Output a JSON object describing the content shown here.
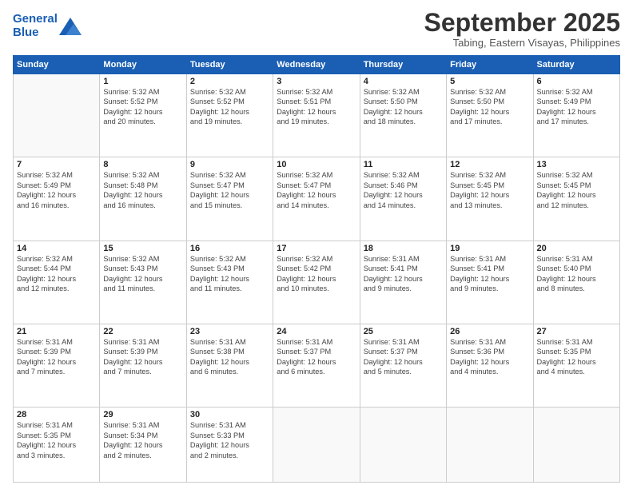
{
  "header": {
    "logo_line1": "General",
    "logo_line2": "Blue",
    "month_title": "September 2025",
    "subtitle": "Tabing, Eastern Visayas, Philippines"
  },
  "days_of_week": [
    "Sunday",
    "Monday",
    "Tuesday",
    "Wednesday",
    "Thursday",
    "Friday",
    "Saturday"
  ],
  "weeks": [
    [
      {
        "day": "",
        "info": ""
      },
      {
        "day": "1",
        "info": "Sunrise: 5:32 AM\nSunset: 5:52 PM\nDaylight: 12 hours\nand 20 minutes."
      },
      {
        "day": "2",
        "info": "Sunrise: 5:32 AM\nSunset: 5:52 PM\nDaylight: 12 hours\nand 19 minutes."
      },
      {
        "day": "3",
        "info": "Sunrise: 5:32 AM\nSunset: 5:51 PM\nDaylight: 12 hours\nand 19 minutes."
      },
      {
        "day": "4",
        "info": "Sunrise: 5:32 AM\nSunset: 5:50 PM\nDaylight: 12 hours\nand 18 minutes."
      },
      {
        "day": "5",
        "info": "Sunrise: 5:32 AM\nSunset: 5:50 PM\nDaylight: 12 hours\nand 17 minutes."
      },
      {
        "day": "6",
        "info": "Sunrise: 5:32 AM\nSunset: 5:49 PM\nDaylight: 12 hours\nand 17 minutes."
      }
    ],
    [
      {
        "day": "7",
        "info": "Sunrise: 5:32 AM\nSunset: 5:49 PM\nDaylight: 12 hours\nand 16 minutes."
      },
      {
        "day": "8",
        "info": "Sunrise: 5:32 AM\nSunset: 5:48 PM\nDaylight: 12 hours\nand 16 minutes."
      },
      {
        "day": "9",
        "info": "Sunrise: 5:32 AM\nSunset: 5:47 PM\nDaylight: 12 hours\nand 15 minutes."
      },
      {
        "day": "10",
        "info": "Sunrise: 5:32 AM\nSunset: 5:47 PM\nDaylight: 12 hours\nand 14 minutes."
      },
      {
        "day": "11",
        "info": "Sunrise: 5:32 AM\nSunset: 5:46 PM\nDaylight: 12 hours\nand 14 minutes."
      },
      {
        "day": "12",
        "info": "Sunrise: 5:32 AM\nSunset: 5:45 PM\nDaylight: 12 hours\nand 13 minutes."
      },
      {
        "day": "13",
        "info": "Sunrise: 5:32 AM\nSunset: 5:45 PM\nDaylight: 12 hours\nand 12 minutes."
      }
    ],
    [
      {
        "day": "14",
        "info": "Sunrise: 5:32 AM\nSunset: 5:44 PM\nDaylight: 12 hours\nand 12 minutes."
      },
      {
        "day": "15",
        "info": "Sunrise: 5:32 AM\nSunset: 5:43 PM\nDaylight: 12 hours\nand 11 minutes."
      },
      {
        "day": "16",
        "info": "Sunrise: 5:32 AM\nSunset: 5:43 PM\nDaylight: 12 hours\nand 11 minutes."
      },
      {
        "day": "17",
        "info": "Sunrise: 5:32 AM\nSunset: 5:42 PM\nDaylight: 12 hours\nand 10 minutes."
      },
      {
        "day": "18",
        "info": "Sunrise: 5:31 AM\nSunset: 5:41 PM\nDaylight: 12 hours\nand 9 minutes."
      },
      {
        "day": "19",
        "info": "Sunrise: 5:31 AM\nSunset: 5:41 PM\nDaylight: 12 hours\nand 9 minutes."
      },
      {
        "day": "20",
        "info": "Sunrise: 5:31 AM\nSunset: 5:40 PM\nDaylight: 12 hours\nand 8 minutes."
      }
    ],
    [
      {
        "day": "21",
        "info": "Sunrise: 5:31 AM\nSunset: 5:39 PM\nDaylight: 12 hours\nand 7 minutes."
      },
      {
        "day": "22",
        "info": "Sunrise: 5:31 AM\nSunset: 5:39 PM\nDaylight: 12 hours\nand 7 minutes."
      },
      {
        "day": "23",
        "info": "Sunrise: 5:31 AM\nSunset: 5:38 PM\nDaylight: 12 hours\nand 6 minutes."
      },
      {
        "day": "24",
        "info": "Sunrise: 5:31 AM\nSunset: 5:37 PM\nDaylight: 12 hours\nand 6 minutes."
      },
      {
        "day": "25",
        "info": "Sunrise: 5:31 AM\nSunset: 5:37 PM\nDaylight: 12 hours\nand 5 minutes."
      },
      {
        "day": "26",
        "info": "Sunrise: 5:31 AM\nSunset: 5:36 PM\nDaylight: 12 hours\nand 4 minutes."
      },
      {
        "day": "27",
        "info": "Sunrise: 5:31 AM\nSunset: 5:35 PM\nDaylight: 12 hours\nand 4 minutes."
      }
    ],
    [
      {
        "day": "28",
        "info": "Sunrise: 5:31 AM\nSunset: 5:35 PM\nDaylight: 12 hours\nand 3 minutes."
      },
      {
        "day": "29",
        "info": "Sunrise: 5:31 AM\nSunset: 5:34 PM\nDaylight: 12 hours\nand 2 minutes."
      },
      {
        "day": "30",
        "info": "Sunrise: 5:31 AM\nSunset: 5:33 PM\nDaylight: 12 hours\nand 2 minutes."
      },
      {
        "day": "",
        "info": ""
      },
      {
        "day": "",
        "info": ""
      },
      {
        "day": "",
        "info": ""
      },
      {
        "day": "",
        "info": ""
      }
    ]
  ]
}
